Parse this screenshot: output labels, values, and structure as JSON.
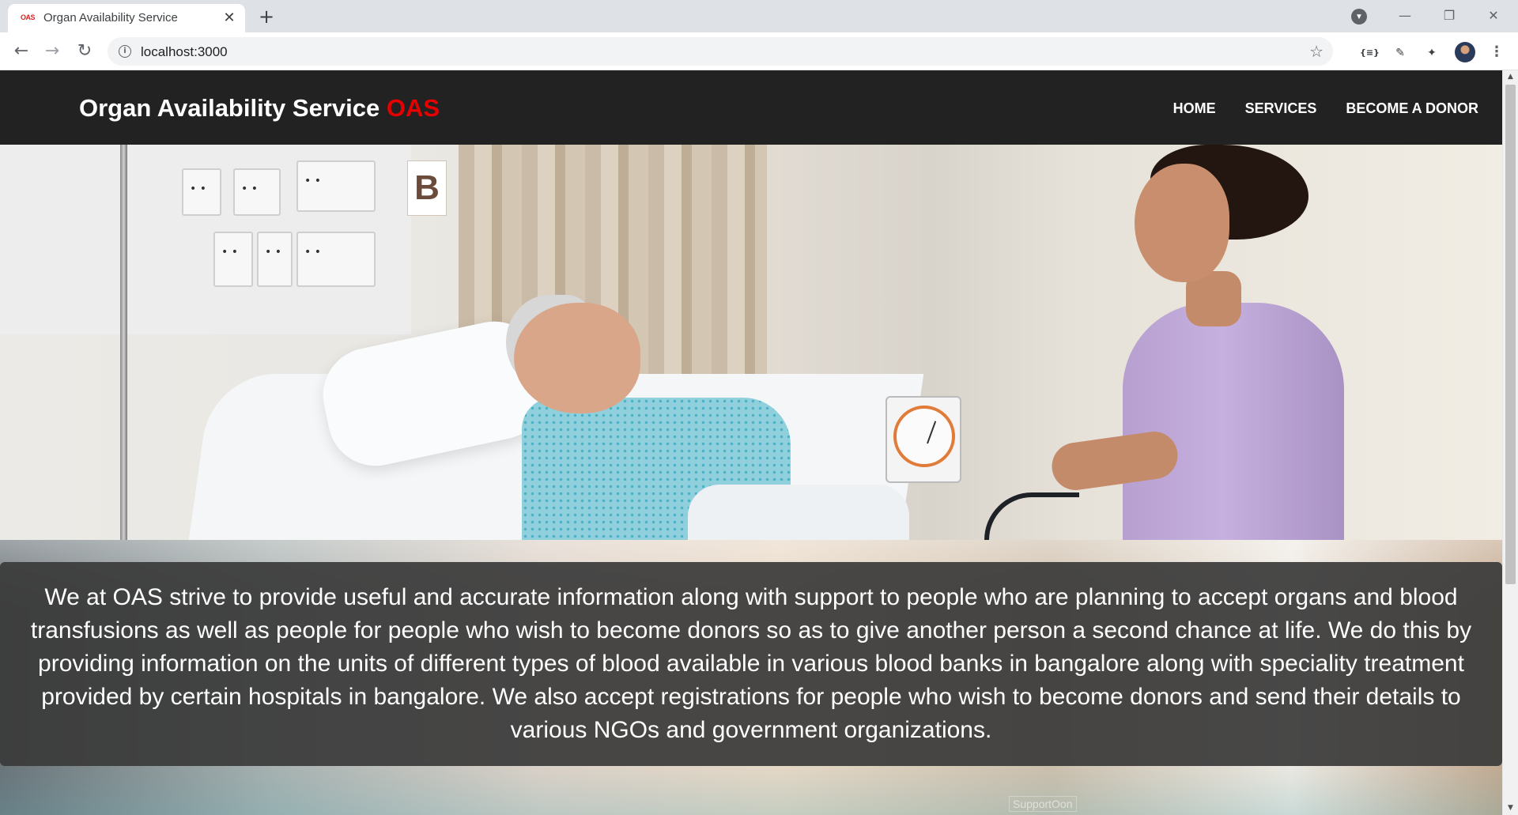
{
  "browser": {
    "tab_favicon": "OAS",
    "tab_title": "Organ Availability Service",
    "tab_close": "✕",
    "new_tab": "+",
    "url": "localhost:3000",
    "window_controls": {
      "minimize": "—",
      "restore": "❐",
      "close": "✕"
    }
  },
  "site": {
    "brand_main": "Organ Availability Service",
    "brand_accent": "OAS",
    "nav": [
      "HOME",
      "SERVICES",
      "BECOME A DONOR"
    ],
    "description": "We at OAS strive to provide useful and accurate information along with support to people who are planning to accept organs and blood transfusions as well as people for people who wish to become donors so as to give another person a second chance at life. We do this by providing information on the units of different types of blood available in various blood banks in bangalore along with speciality treatment provided by certain hospitals in bangalore. We also accept registrations for people who wish to become donors and send their details to various NGOs and government organizations.",
    "overlay_tag": "SupportOon"
  },
  "hero_image": {
    "alt": "Nurse checking an elderly patient's blood pressure in a hospital room",
    "door_letter": "B"
  },
  "colors": {
    "navbar": "#222222",
    "brand_accent": "#e60000",
    "panel": "#3a3a3a"
  },
  "icons": [
    "back-icon",
    "forward-icon",
    "reload-icon",
    "info-icon",
    "star-icon",
    "extensions-icon",
    "profile-avatar",
    "menu-icon"
  ]
}
